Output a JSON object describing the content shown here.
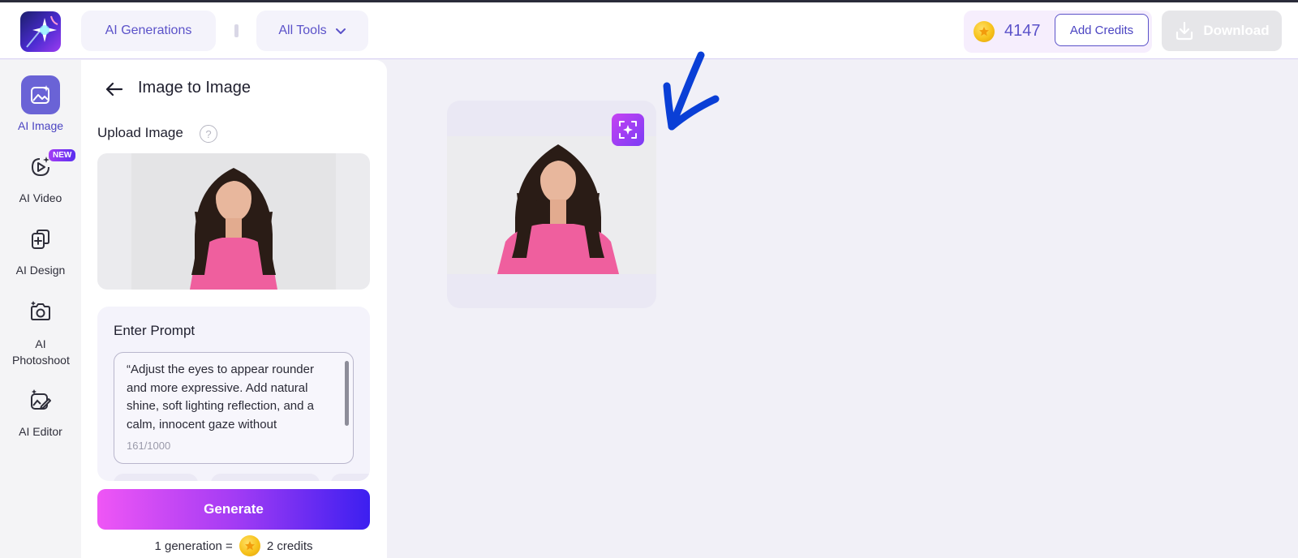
{
  "header": {
    "ai_generations_label": "AI Generations",
    "all_tools_label": "All Tools",
    "credits": "4147",
    "add_credits_label": "Add Credits",
    "download_label": "Download"
  },
  "sidebar": {
    "items": [
      {
        "label": "AI Image",
        "icon": "ai-image-icon",
        "active": true
      },
      {
        "label": "AI Video",
        "icon": "ai-video-icon",
        "badge": "NEW"
      },
      {
        "label": "AI Design",
        "icon": "ai-design-icon"
      },
      {
        "label": "AI Photoshoot",
        "icon": "ai-photoshoot-icon"
      },
      {
        "label": "AI Editor",
        "icon": "ai-editor-icon"
      }
    ]
  },
  "panel": {
    "title": "Image to Image",
    "upload_label": "Upload Image",
    "prompt_label": "Enter Prompt",
    "prompt_text": "“Adjust the eyes to appear rounder and more expressive. Add natural shine, soft lighting reflection, and a calm, innocent gaze without",
    "prompt_count": "161/1000",
    "generate_label": "Generate",
    "note_prefix": "1 generation =",
    "note_suffix": "2 credits"
  },
  "colors": {
    "accent": "#5b52c9",
    "generate_gradient_start": "#ef56f5",
    "generate_gradient_end": "#3c1ff0",
    "annotation_arrow": "#0a3fd6"
  }
}
